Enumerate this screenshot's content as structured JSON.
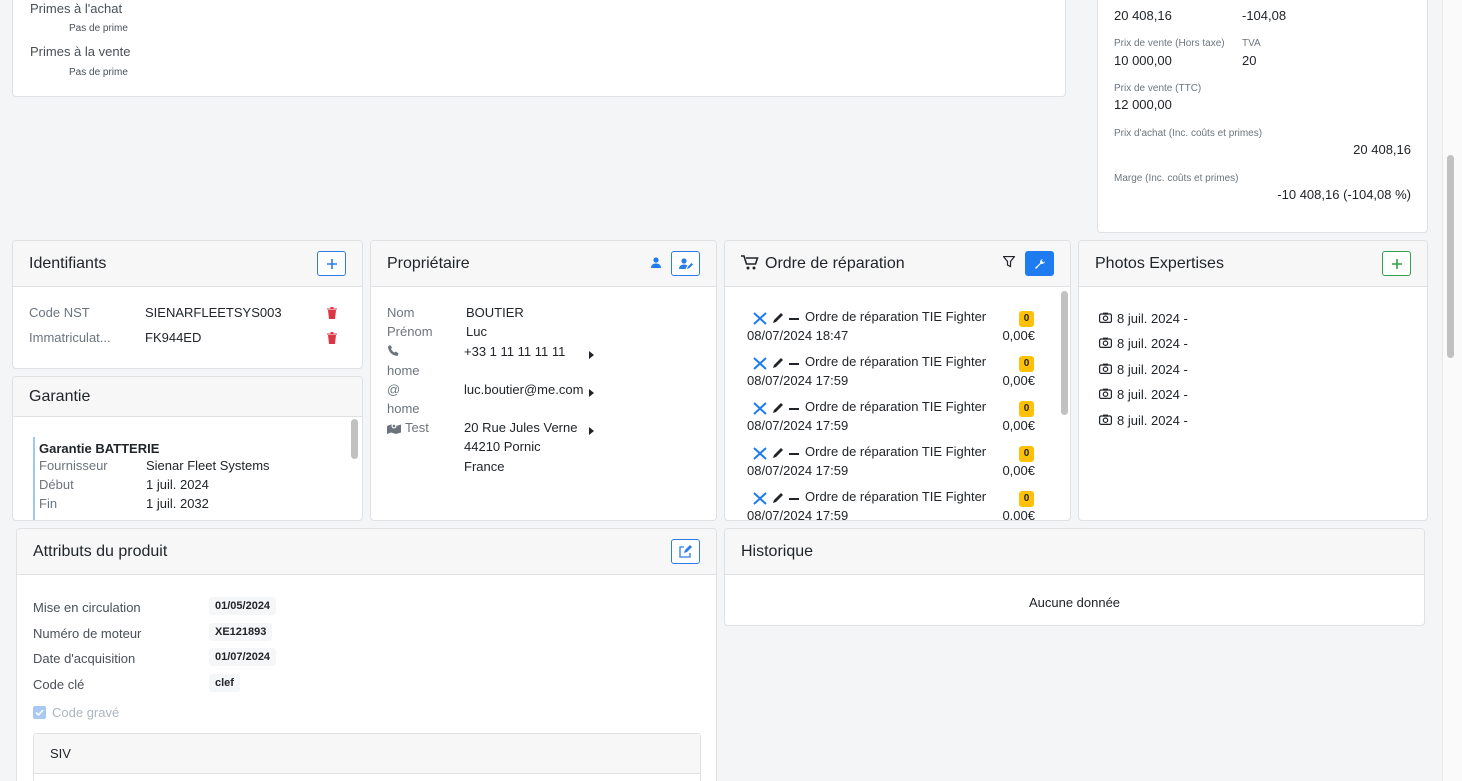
{
  "top_left": {
    "primes_achat_label": "Primes à l'achat",
    "primes_achat_value": "Pas de prime",
    "primes_vente_label": "Primes à la vente",
    "primes_vente_value": "Pas de prime"
  },
  "prices": {
    "prix_achat_ttc_value": "20 408,16",
    "marge_value": "-104,08",
    "prix_vente_ht_label": "Prix de vente (Hors taxe)",
    "prix_vente_ht_value": "10 000,00",
    "tva_label": "TVA",
    "tva_value": "20",
    "prix_vente_ttc_label": "Prix de vente (TTC)",
    "prix_vente_ttc_value": "12 000,00",
    "prix_achat_inc_label": "Prix d'achat (Inc. coûts et primes)",
    "prix_achat_inc_value": "20 408,16",
    "marge_inc_label": "Marge (Inc. coûts et primes)",
    "marge_inc_value": "-10 408,16 (-104,08 %)"
  },
  "identifiants": {
    "title": "Identifiants",
    "rows": [
      {
        "label": "Code NST",
        "value": "SIENARFLEETSYS003"
      },
      {
        "label": "Immatriculat...",
        "value": "FK944ED"
      }
    ]
  },
  "garantie": {
    "title": "Garantie",
    "name": "Garantie BATTERIE",
    "fournisseur_label": "Fournisseur",
    "fournisseur_value": "Sienar Fleet Systems",
    "debut_label": "Début",
    "debut_value": "1 juil. 2024",
    "fin_label": "Fin",
    "fin_value": "1 juil. 2032"
  },
  "proprietaire": {
    "title": "Propriétaire",
    "nom_label": "Nom",
    "nom_value": "BOUTIER",
    "prenom_label": "Prénom",
    "prenom_value": "Luc",
    "phone_type": "home",
    "phone_value": "+33 1 11 11 11 11",
    "email_symbol": "@",
    "email_type": "home",
    "email_value": "luc.boutier@me.com",
    "address_type": "Test",
    "address_line1": "20 Rue Jules Verne",
    "address_line2": "44210 Pornic",
    "address_line3": "France"
  },
  "ordres": {
    "title": "Ordre de réparation",
    "items": [
      {
        "name": "Ordre de réparation TIE Fighter",
        "date": "08/07/2024 18:47",
        "count": "0",
        "amount": "0,00€"
      },
      {
        "name": "Ordre de réparation TIE Fighter",
        "date": "08/07/2024 17:59",
        "count": "0",
        "amount": "0,00€"
      },
      {
        "name": "Ordre de réparation TIE Fighter",
        "date": "08/07/2024 17:59",
        "count": "0",
        "amount": "0,00€"
      },
      {
        "name": "Ordre de réparation TIE Fighter",
        "date": "08/07/2024 17:59",
        "count": "0",
        "amount": "0,00€"
      },
      {
        "name": "Ordre de réparation TIE Fighter",
        "date": "08/07/2024 17:59",
        "count": "0",
        "amount": "0,00€"
      }
    ]
  },
  "photos": {
    "title": "Photos Expertises",
    "items": [
      "8 juil. 2024 -",
      "8 juil. 2024 -",
      "8 juil. 2024 -",
      "8 juil. 2024 -",
      "8 juil. 2024 -"
    ]
  },
  "attributs": {
    "title": "Attributs du produit",
    "rows": [
      {
        "label": "Mise en circulation",
        "value": "01/05/2024"
      },
      {
        "label": "Numéro de moteur",
        "value": "XE121893"
      },
      {
        "label": "Date d'acquisition",
        "value": "01/07/2024"
      },
      {
        "label": "Code clé",
        "value": "clef"
      }
    ],
    "checkbox_label": "Code gravé",
    "siv_label": "SIV"
  },
  "historique": {
    "title": "Historique",
    "empty": "Aucune donnée"
  }
}
